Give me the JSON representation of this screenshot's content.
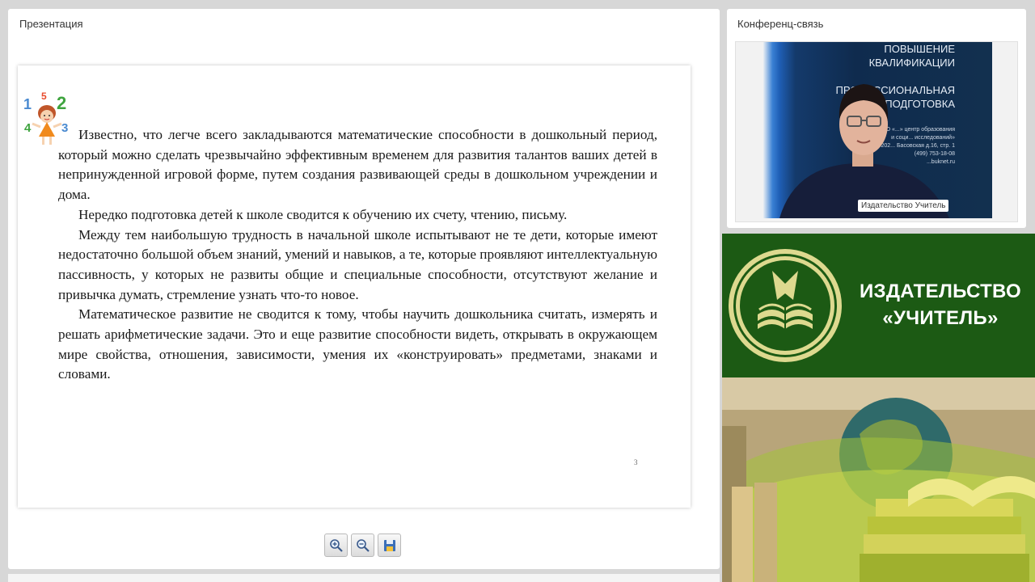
{
  "presentation": {
    "panel_title": "Презентация",
    "slide": {
      "paragraphs": [
        "Известно, что легче всего закладываются математические способности в дошкольный период, который можно сделать чрезвычайно эффективным временем для развития талантов ваших детей в непринужденной игровой форме, путем создания развивающей среды в дошкольном учреждении и дома.",
        "Нередко подготовка детей к школе сводится к обучению их счету, чтению, письму.",
        "Между тем наибольшую трудность в начальной школе испытывают не те дети, которые имеют недостаточно большой объем знаний, умений и навыков, а те, которые проявляют интеллектуальную пассивность, у которых не развиты общие и специальные способности, отсутствуют желание и привычка думать, стремление узнать что-то новое.",
        "Математическое развитие не сводится к тому, чтобы научить дошкольника считать, измерять и решать арифметические задачи. Это и еще развитие способности видеть, открывать в окружающем мире свойства, отношения, зависимости, умения их «конструировать» предметами, знаками и словами."
      ],
      "logo_digits": [
        "1",
        "5",
        "2",
        "4",
        "3"
      ],
      "page_number": "3"
    },
    "toolbar": {
      "zoom_in_icon": "zoom-in-icon",
      "zoom_out_icon": "zoom-out-icon",
      "save_icon": "save-icon"
    }
  },
  "conference": {
    "panel_title": "Конференц-связь",
    "banner_lines": [
      "ПОВЫШЕНИЕ",
      "КВАЛИФИКАЦИИ",
      "",
      "ПРОФЕССИОНАЛЬНАЯ",
      "ПОДГОТОВКА"
    ],
    "banner_small_lines": [
      "ООО «...» центр образования",
      "и соци... исследований»",
      "109202... Басовская д.16, стр. 1",
      "(499) 753-18-08",
      "...buknet.ru"
    ],
    "participant_label": "Издательство Учитель"
  },
  "brand": {
    "line1": "ИЗДАТЕЛЬСТВО",
    "line2": "«УЧИТЕЛЬ»",
    "colors": {
      "green": "#1c5a14",
      "emblem": "#e8e6a0"
    }
  }
}
